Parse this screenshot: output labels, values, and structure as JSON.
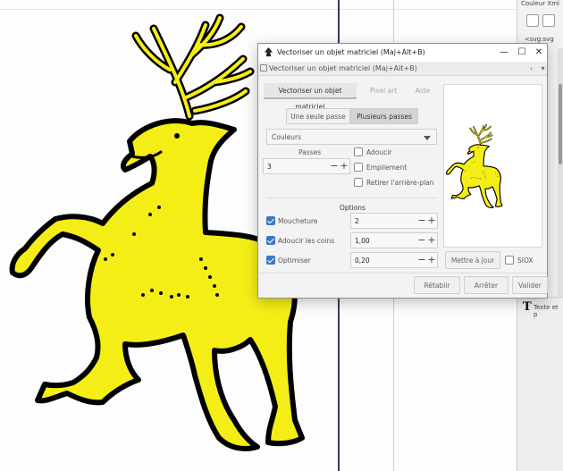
{
  "dock": {
    "top_label": "Couleur Xml",
    "node_label": "<svg:svg",
    "text_tool_label": "Texte et p"
  },
  "dialog": {
    "window_title": "Vectoriser un objet matriciel (Maj+Alt+B)",
    "sub_title": "Vectoriser un objet matriciel (Maj+Alt+B)",
    "tabs": [
      {
        "label": "Vectoriser un objet matriciel",
        "active": true
      },
      {
        "label": "Pixel art",
        "active": false
      },
      {
        "label": "Aide",
        "active": false
      }
    ],
    "mode_buttons": {
      "single": "Une seule passe",
      "multiple": "Plusieurs passes"
    },
    "color_select": {
      "value": "Couleurs"
    },
    "passes": {
      "label": "Passes",
      "value": "3"
    },
    "checks_right": [
      {
        "label": "Adoucir",
        "checked": false
      },
      {
        "label": "Empilement",
        "checked": false
      },
      {
        "label": "Retirer l'arrière-plan",
        "checked": false
      }
    ],
    "options_header": "Options",
    "options": [
      {
        "label": "Moucheture",
        "checked": true,
        "value": "2"
      },
      {
        "label": "Adoucir les coins",
        "checked": true,
        "value": "1,00"
      },
      {
        "label": "Optimiser",
        "checked": true,
        "value": "0,20"
      }
    ],
    "update_button": "Mettre à jour",
    "siox": {
      "label": "SIOX",
      "checked": false
    },
    "footer": {
      "reset": "Rétablir",
      "stop": "Arrêter",
      "validate": "Valider"
    },
    "win_controls": {
      "minimize": "—",
      "maximize": "☐",
      "close": "✕"
    }
  },
  "colors": {
    "stag_fill": "#f5ee16",
    "stag_outline": "#000000",
    "check_accent": "#3b78c4"
  }
}
